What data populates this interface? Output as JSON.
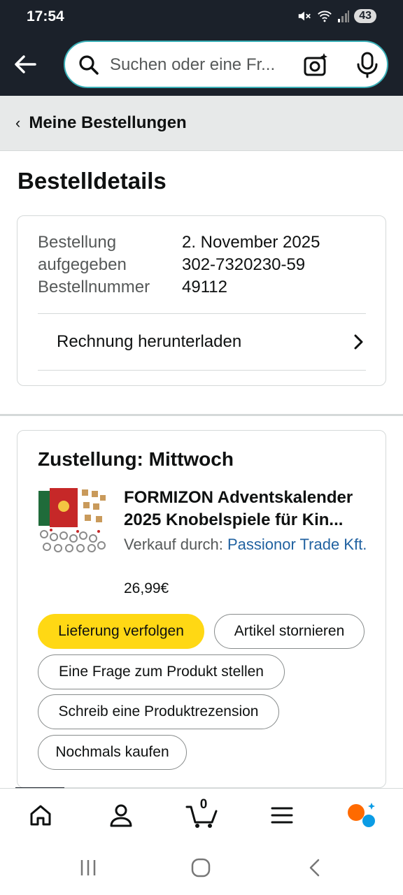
{
  "status": {
    "time": "17:54",
    "battery": "43"
  },
  "search": {
    "placeholder": "Suchen oder eine Fr..."
  },
  "breadcrumb": {
    "label": "Meine Bestellungen"
  },
  "page": {
    "title": "Bestelldetails"
  },
  "order_info": {
    "placed_label": "Bestellung aufgegeben",
    "placed_value": "2. November 2025",
    "number_label": "Bestellnummer",
    "number_value": "302-7320230-5949112",
    "invoice_label": "Rechnung herunterladen"
  },
  "delivery": {
    "title": "Zustellung: Mittwoch",
    "product_title": "FORMIZON Adventskalender 2025 Knobelspiele für Kin...",
    "seller_label": "Verkauf durch:",
    "seller_name": "Passionor Trade Kft.",
    "price": "26,99€",
    "buttons": {
      "track": "Lieferung verfolgen",
      "cancel": "Artikel stornieren",
      "question": "Eine Frage zum Produkt stellen",
      "review": "Schreib eine Produktrezension",
      "buy_again": "Nochmals kaufen"
    }
  },
  "bottom_nav": {
    "cart_count": "0"
  },
  "colors": {
    "header_bg": "#1b212a",
    "primary_button": "#ffd814",
    "link": "#2162a1",
    "assistant_orange": "#ff6a00",
    "assistant_blue": "#0b9ce5"
  }
}
